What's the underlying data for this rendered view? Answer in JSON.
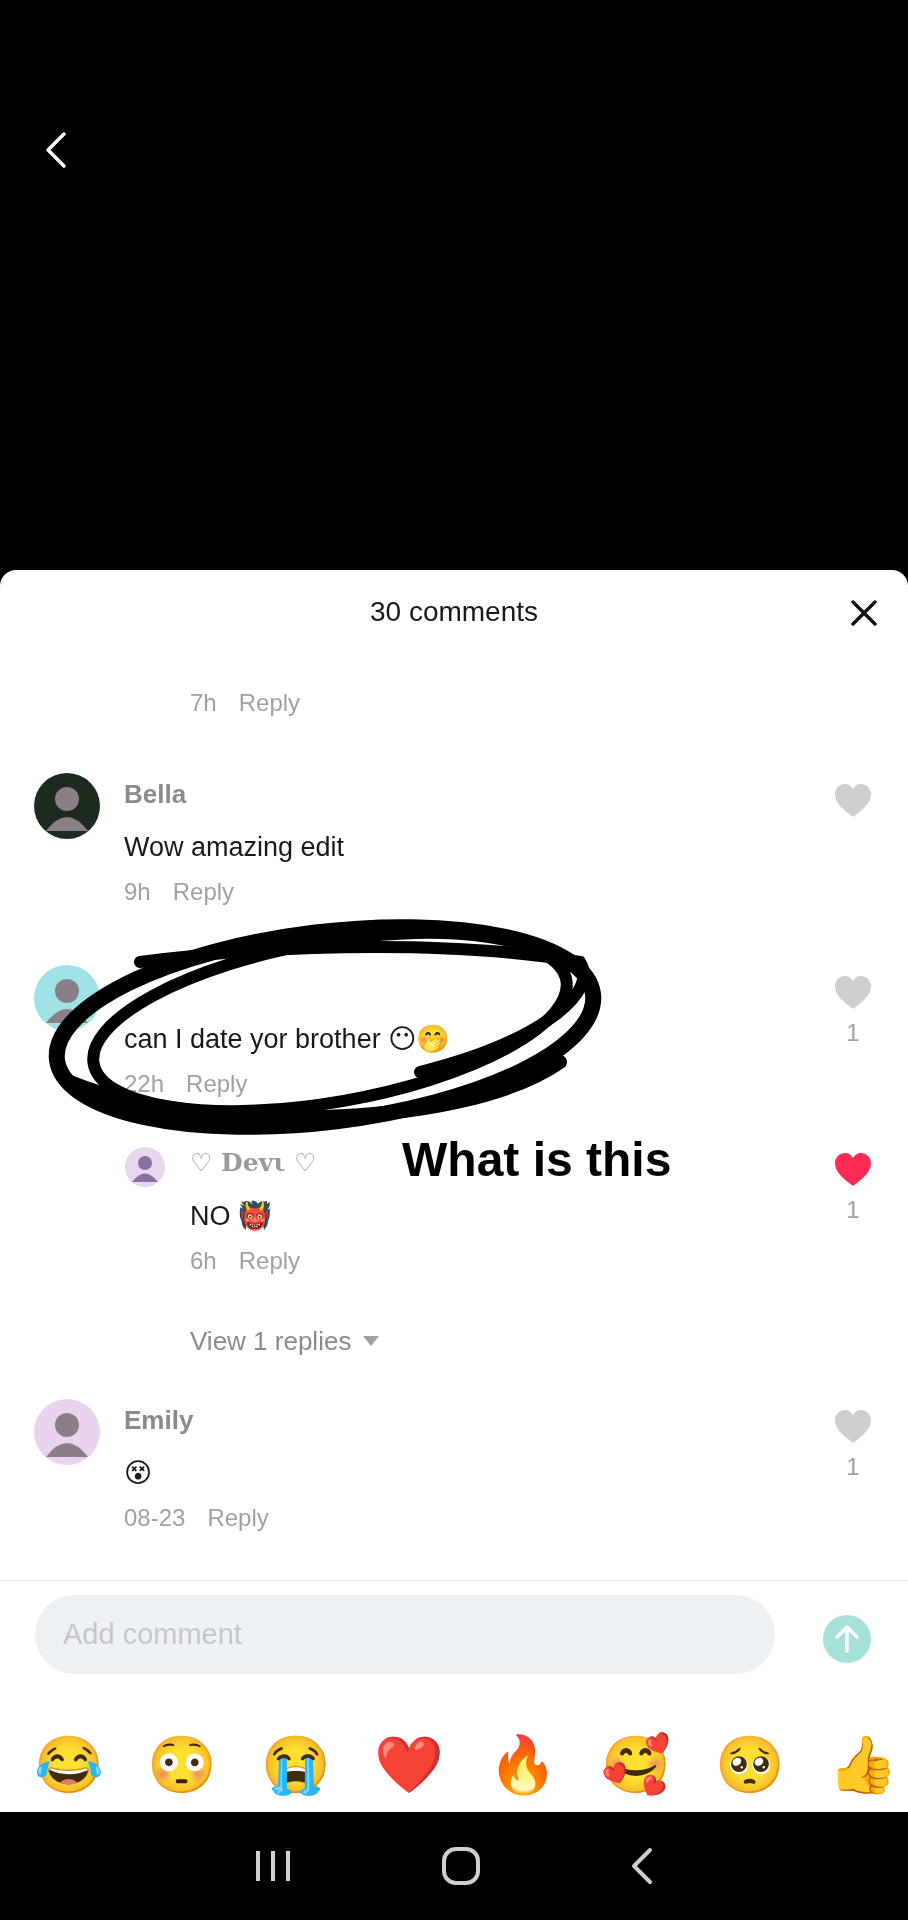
{
  "header": {
    "title": "30 comments"
  },
  "comments": [
    {
      "replies": [
        {
          "time": "7h",
          "reply": "Reply"
        }
      ]
    },
    {
      "name": "Bella",
      "text": "Wow amazing edit",
      "time": "9h",
      "reply": "Reply",
      "liked": false
    },
    {
      "text": "can I date yor brother 😶🤭",
      "time": "22h",
      "reply": "Reply",
      "liked": false,
      "likes": "1",
      "replies": [
        {
          "name": "♡ Devι ♡",
          "text": "NO 👹",
          "time": "6h",
          "reply": "Reply",
          "liked": true,
          "likes": "1"
        }
      ],
      "more": "View 1 replies"
    },
    {
      "name": "Emily",
      "text": "😵",
      "time": "08-23",
      "reply": "Reply",
      "liked": false,
      "likes": "1"
    }
  ],
  "overlay": {
    "caption": "What is this"
  },
  "composer": {
    "placeholder": "Add comment"
  },
  "quick_emojis": [
    "😂",
    "😳",
    "😭",
    "❤️",
    "🔥",
    "🥰",
    "🥺",
    "👍"
  ]
}
